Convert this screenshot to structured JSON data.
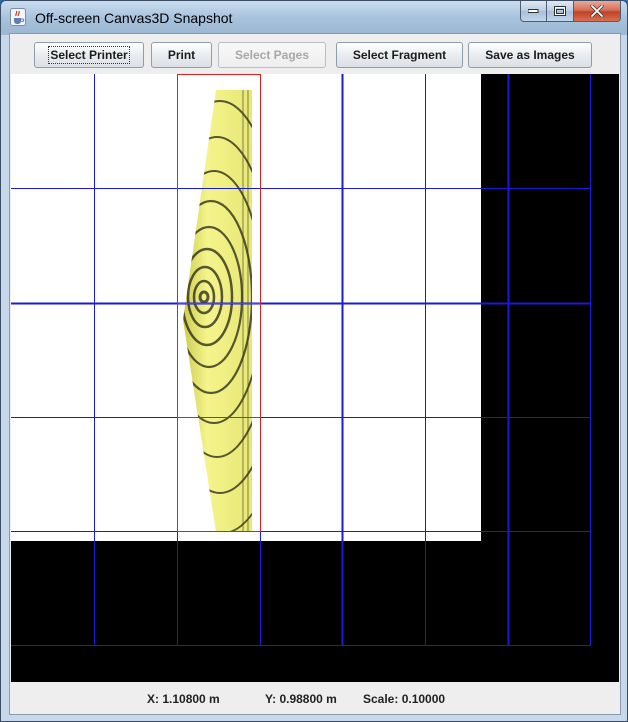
{
  "window": {
    "title": "Off-screen Canvas3D Snapshot",
    "icon": "java-cup-icon",
    "controls": [
      "minimize-icon",
      "maximize-icon",
      "close-icon"
    ]
  },
  "toolbar": {
    "select_printer_label": "Select Printer",
    "print_label": "Print",
    "select_pages_label": "Select Pages",
    "select_fragment_label": "Select Fragment",
    "save_as_images_label": "Save as Images"
  },
  "canvas": {
    "background_color": "#000000",
    "page_color": "#ffffff",
    "grid_color": "#1a1adb",
    "selection_color": "#e02020",
    "surface_color": "#e8e870"
  },
  "status": {
    "x_text": "X: 1.10800 m",
    "y_text": "Y: 0.98800 m",
    "scale_text": "Scale: 0.10000"
  }
}
